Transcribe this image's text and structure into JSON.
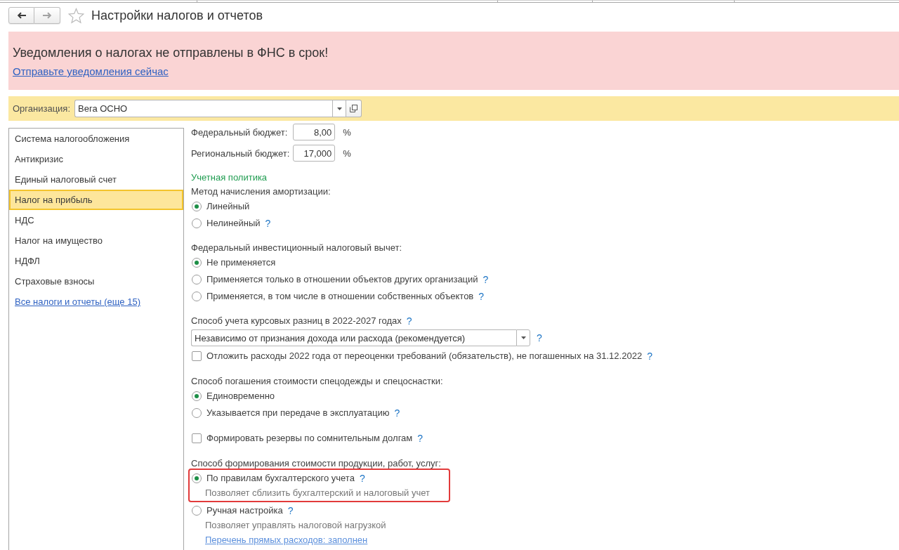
{
  "header": {
    "nav_buttons": [
      {
        "kind": "back",
        "disabled": false
      },
      {
        "kind": "forward",
        "disabled": true
      }
    ],
    "favorite": false,
    "title": "Настройки налогов и отчетов"
  },
  "alert": {
    "message": "Уведомления о налогах не отправлены в ФНС в срок!",
    "link": "Отправьте уведомления сейчас"
  },
  "organization": {
    "label": "Организация:",
    "value": "Вега ОСНО"
  },
  "sidebar": {
    "items": [
      {
        "label": "Система налогообложения",
        "selected": false
      },
      {
        "label": "Антикризис",
        "selected": false
      },
      {
        "label": "Единый налоговый счет",
        "selected": false
      },
      {
        "label": "Налог на прибыль",
        "selected": true
      },
      {
        "label": "НДС",
        "selected": false
      },
      {
        "label": "Налог на имущество",
        "selected": false
      },
      {
        "label": "НДФЛ",
        "selected": false
      },
      {
        "label": "Страховые взносы",
        "selected": false
      }
    ],
    "link": "Все налоги и отчеты (еще 15)"
  },
  "content": {
    "rates": [
      {
        "label": "Федеральный бюджет:",
        "value": "8,00",
        "unit": "%"
      },
      {
        "label": "Региональный бюджет:",
        "value": "17,000",
        "unit": "%"
      }
    ],
    "section_title": "Учетная политика",
    "sections": [
      {
        "rows": [
          {
            "kind": "label",
            "text": "Метод начисления амортизации:"
          },
          {
            "kind": "radio",
            "label": "Линейный",
            "selected": true,
            "highlighted": false
          },
          {
            "kind": "radio",
            "label": "Нелинейный",
            "help": "?",
            "selected": false,
            "highlighted": false
          }
        ]
      },
      {
        "rows": [
          {
            "kind": "label",
            "text": "Федеральный инвестиционный налоговый вычет:"
          },
          {
            "kind": "radio",
            "label": "Не применяется",
            "selected": true,
            "highlighted": false
          },
          {
            "kind": "radio",
            "label": "Применяется только в отношении объектов других организаций",
            "help": "?",
            "selected": false,
            "highlighted": false
          },
          {
            "kind": "radio",
            "label": "Применяется, в том числе в отношении собственных объектов",
            "help": "?",
            "selected": false,
            "highlighted": false
          }
        ]
      },
      {
        "rows": [
          {
            "kind": "label",
            "text": "Способ учета курсовых разниц в 2022-2027 годах",
            "help": "?"
          },
          {
            "kind": "select",
            "value": "Независимо от признания дохода или расхода (рекомендуется)",
            "help": "?"
          },
          {
            "kind": "checkbox",
            "label": "Отложить расходы 2022 года от переоценки требований (обязательств), не погашенных на 31.12.2022",
            "help": "?",
            "checked": false
          }
        ]
      },
      {
        "rows": [
          {
            "kind": "label",
            "text": "Способ погашения стоимости спецодежды и спецоснастки:"
          },
          {
            "kind": "radio",
            "label": "Единовременно",
            "selected": true,
            "highlighted": false
          },
          {
            "kind": "radio",
            "label": "Указывается при передаче в эксплуатацию",
            "help": "?",
            "selected": false,
            "highlighted": false
          }
        ]
      },
      {
        "rows": [
          {
            "kind": "checkbox",
            "label": "Формировать резервы по сомнительным долгам",
            "help": "?",
            "checked": false
          }
        ]
      },
      {
        "rows": [
          {
            "kind": "label",
            "text": "Способ формирования стоимости продукции, работ, услуг:"
          },
          {
            "kind": "radio",
            "label": "По правилам бухгалтерского учета",
            "help": "?",
            "selected": true,
            "highlighted": true,
            "note": "Позволяет сблизить бухгалтерский и налоговый учет"
          },
          {
            "kind": "radio",
            "label": "Ручная настройка",
            "help": "?",
            "selected": false,
            "highlighted": false,
            "note": "Позволяет управлять налоговой нагрузкой",
            "link": "Перечень прямых расходов: заполнен"
          }
        ]
      }
    ]
  }
}
